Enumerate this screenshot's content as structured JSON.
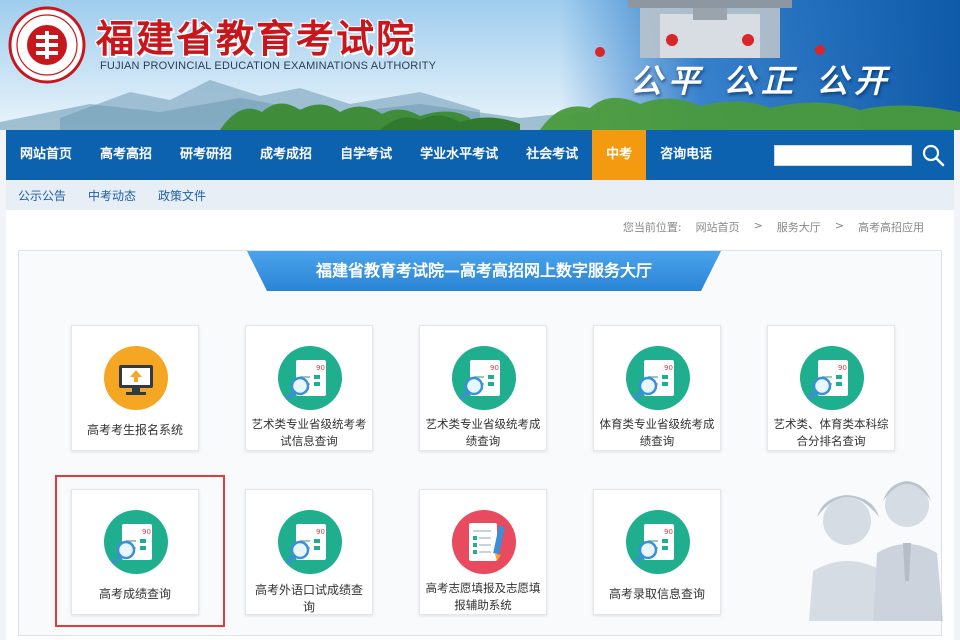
{
  "header": {
    "title": "福建省教育考试院",
    "subtitle": "FUJIAN PROVINCIAL EDUCATION EXAMINATIONS AUTHORITY",
    "slogan": "公平 公正 公开",
    "colors": {
      "title": "#c8161d",
      "nav": "#0d62b0",
      "active": "#f39a10"
    }
  },
  "nav": {
    "items": [
      {
        "label": "网站首页"
      },
      {
        "label": "高考高招"
      },
      {
        "label": "研考研招"
      },
      {
        "label": "成考成招"
      },
      {
        "label": "自学考试"
      },
      {
        "label": "学业水平考试"
      },
      {
        "label": "社会考试"
      },
      {
        "label": "中考",
        "active": true
      },
      {
        "label": "咨询电话"
      }
    ],
    "search": {
      "value": "",
      "placeholder": ""
    }
  },
  "subnav": {
    "items": [
      {
        "label": "公示公告"
      },
      {
        "label": "中考动态"
      },
      {
        "label": "政策文件"
      }
    ]
  },
  "breadcrumb": {
    "prefix": "您当前位置:",
    "items": [
      "网站首页",
      "服务大厅",
      "高考高招应用"
    ],
    "separator": ">"
  },
  "panel": {
    "title": "福建省教育考试院—高考高招网上数字服务大厅",
    "cards": [
      {
        "label": "高考考生报名系统",
        "icon": "monitor-upload-icon"
      },
      {
        "label": "艺术类专业省级统考考试信息查询",
        "icon": "score-report-icon"
      },
      {
        "label": "艺术类专业省级统考成绩查询",
        "icon": "score-report-icon"
      },
      {
        "label": "体育类专业省级统考成绩查询",
        "icon": "score-report-icon"
      },
      {
        "label": "艺术类、体育类本科综合分排名查询",
        "icon": "score-report-icon"
      },
      {
        "label": "高考成绩查询",
        "icon": "score-report-icon",
        "highlighted": true
      },
      {
        "label": "高考外语口试成绩查询",
        "icon": "score-report-icon"
      },
      {
        "label": "高考志愿填报及志愿填报辅助系统",
        "icon": "application-form-icon"
      },
      {
        "label": "高考录取信息查询",
        "icon": "score-report-icon"
      }
    ]
  }
}
